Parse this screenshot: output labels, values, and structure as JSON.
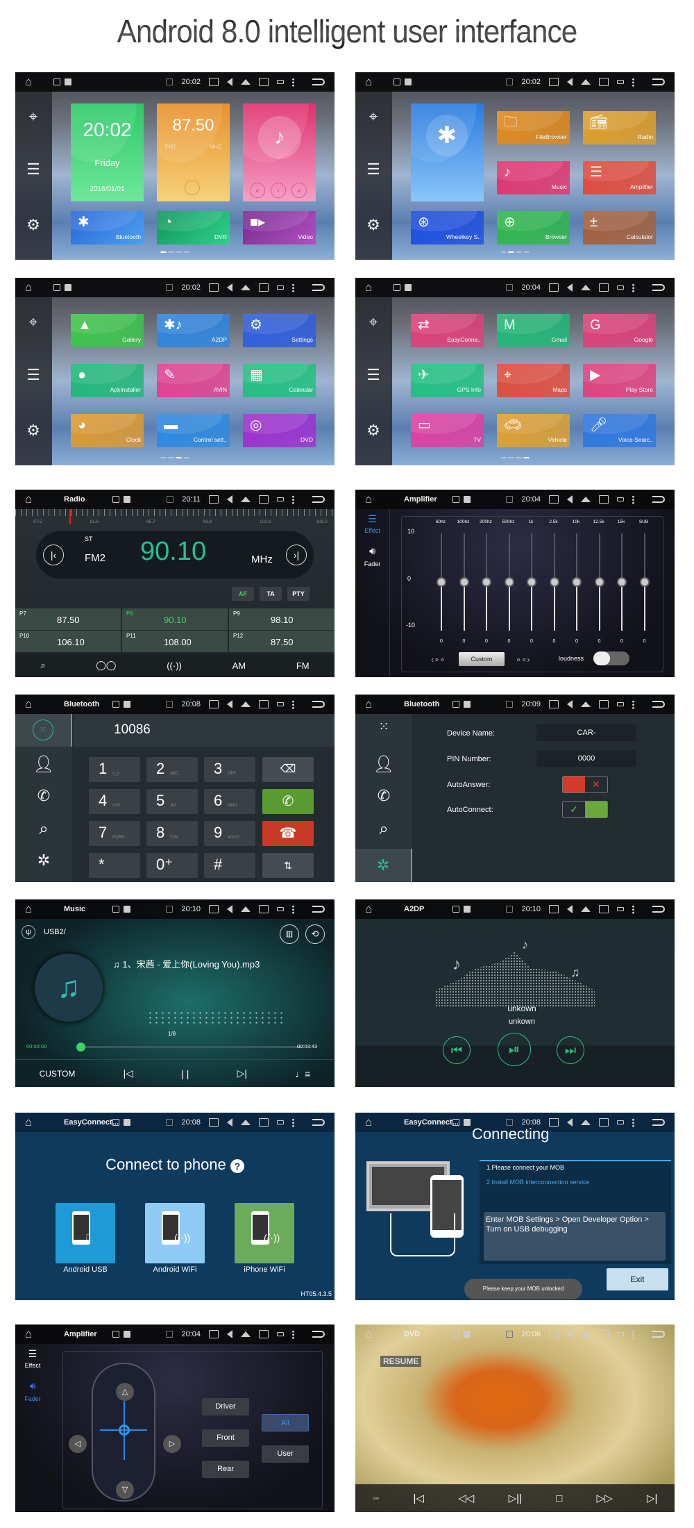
{
  "title": "Android 8.0 intelligent user interfance",
  "statusbar_icons": [
    "home-icon",
    "gallery-icon",
    "sd-card-icon",
    "no-sim-icon",
    "screenshot-icon",
    "volume-icon",
    "eject-icon",
    "close-window-icon",
    "recent-apps-icon",
    "more-icon",
    "back-icon"
  ],
  "screens": {
    "home1": {
      "time": "20:02",
      "clock": {
        "time": "20:02",
        "day": "Friday",
        "date": "2016/01/01"
      },
      "radio_widget": {
        "freq": "87.50",
        "band": "FM1",
        "unit": "MHZ"
      },
      "tiles": [
        {
          "label": "Bluetooth",
          "color": "#2f6fe0"
        },
        {
          "label": "DVR",
          "color": "#1aa56a"
        },
        {
          "label": "Video",
          "color": "#8e2fa0"
        }
      ]
    },
    "home2": {
      "time": "20:02",
      "tiles": [
        {
          "label": "FileBrowser",
          "color": "#e08a1c"
        },
        {
          "label": "Radio",
          "color": "#e0a02a"
        },
        {
          "label": "Music",
          "color": "#e0356e"
        },
        {
          "label": "Amplifier",
          "color": "#e04a3a"
        },
        {
          "label": "Wheelkey S..",
          "color": "#1e4fe0"
        },
        {
          "label": "Browser",
          "color": "#2fb84a"
        },
        {
          "label": "Calculator",
          "color": "#a5603a"
        }
      ]
    },
    "home3": {
      "time": "20:02",
      "tiles": [
        {
          "label": "Gallery",
          "color": "#3cc74a"
        },
        {
          "label": "A2DP",
          "color": "#2f86e0"
        },
        {
          "label": "Settings",
          "color": "#2f5ee0"
        },
        {
          "label": "ApkInstaller",
          "color": "#20b878"
        },
        {
          "label": "AVIN",
          "color": "#e0408e"
        },
        {
          "label": "Calendar",
          "color": "#20c080"
        },
        {
          "label": "Clock",
          "color": "#e09a30"
        },
        {
          "label": "Control sett..",
          "color": "#2f8ae0"
        },
        {
          "label": "DVD",
          "color": "#a030d0"
        }
      ]
    },
    "home4": {
      "time": "20:04",
      "tiles": [
        {
          "label": "EasyConne..",
          "color": "#e0407a"
        },
        {
          "label": "Gmail",
          "color": "#20b878"
        },
        {
          "label": "Google",
          "color": "#e0407a"
        },
        {
          "label": "GPS Info",
          "color": "#20c080"
        },
        {
          "label": "Maps",
          "color": "#e04a3a"
        },
        {
          "label": "Play Store",
          "color": "#e0407a"
        },
        {
          "label": "TV",
          "color": "#e040a0"
        },
        {
          "label": "Vehicle",
          "color": "#e0a030"
        },
        {
          "label": "Voice Searc..",
          "color": "#2f78e0"
        }
      ]
    },
    "radio": {
      "app": "Radio",
      "time": "20:11",
      "scale": [
        "87.5",
        "91.6",
        "95.7",
        "99.8",
        "103.9",
        "108.0"
      ],
      "st": "ST",
      "band": "FM2",
      "freq": "90.10",
      "unit": "MHz",
      "flags": [
        "AF",
        "TA",
        "PTY"
      ],
      "presets": [
        {
          "p": "P7",
          "f": "87.50"
        },
        {
          "p": "P8",
          "f": "90.10",
          "active": true
        },
        {
          "p": "P9",
          "f": "98.10"
        },
        {
          "p": "P10",
          "f": "106.10"
        },
        {
          "p": "P11",
          "f": "108.00"
        },
        {
          "p": "P12",
          "f": "87.50"
        }
      ],
      "bottom": [
        "search",
        "stereo",
        "rds",
        "AM",
        "FM"
      ],
      "am": "AM",
      "fm": "FM"
    },
    "eq": {
      "app": "Amplifier",
      "time": "20:04",
      "effect": "Effect",
      "fader": "Fader",
      "bands": [
        "60hz",
        "100hz",
        "200hz",
        "500hz",
        "1k",
        "2.5k",
        "10k",
        "12.5k",
        "15k",
        "SUB"
      ],
      "values": [
        0,
        0,
        0,
        0,
        0,
        0,
        0,
        0,
        0,
        0
      ],
      "scale": [
        "10",
        "0",
        "-10"
      ],
      "preset": "Custom",
      "loudness": "loudness"
    },
    "dialer": {
      "app": "Bluetooth",
      "time": "20:08",
      "number": "10086",
      "keys": [
        {
          "d": "1",
          "s": "ᴏ_ᴏ"
        },
        {
          "d": "2",
          "s": "ABC"
        },
        {
          "d": "3",
          "s": "DEF"
        },
        {
          "d": "4",
          "s": "GHI"
        },
        {
          "d": "5",
          "s": "JKL"
        },
        {
          "d": "6",
          "s": "MNO"
        },
        {
          "d": "7",
          "s": "PQRS"
        },
        {
          "d": "8",
          "s": "TUV"
        },
        {
          "d": "9",
          "s": "WXYZ"
        },
        {
          "d": "*",
          "s": ""
        },
        {
          "d": "0⁺",
          "s": ""
        },
        {
          "d": "#",
          "s": ""
        }
      ]
    },
    "bt_settings": {
      "app": "Bluetooth",
      "time": "20:09",
      "device_name_label": "Device Name:",
      "device_name": "CAR-",
      "pin_label": "PIN Number:",
      "pin": "0000",
      "auto_answer_label": "AutoAnswer:",
      "auto_answer": false,
      "auto_connect_label": "AutoConnect:",
      "auto_connect": true
    },
    "music": {
      "app": "Music",
      "time": "20:10",
      "source": "USB2/",
      "song": "1、宋茜 - 爱上你(Loving You).mp3",
      "track": "1/8",
      "elapsed": "00:00:00",
      "total": "00:03:43",
      "progress": 0,
      "mode": "CUSTOM"
    },
    "a2dp": {
      "app": "A2DP",
      "time": "20:10",
      "title": "unkown",
      "artist": "unkown"
    },
    "easyconnect": {
      "app": "EasyConnect...",
      "time": "20:08",
      "heading": "Connect to phone",
      "options": [
        {
          "label": "Android USB",
          "color": "#1e9ad6"
        },
        {
          "label": "Android WiFi",
          "color": "#8ecbf5"
        },
        {
          "label": "iPhone WiFi",
          "color": "#6aac5a"
        }
      ],
      "version": "HT05.4.3.5"
    },
    "connecting": {
      "app": "EasyConnect...",
      "time": "20:08",
      "heading": "Connecting",
      "step1": "1.Please connect your MOB",
      "step2": "2.Install MOB interconnection service",
      "instructions": "Enter MOB Settings > Open Developer Option > Turn on USB debugging",
      "exit": "Exit",
      "toast": "Please keep your MOB unlocked"
    },
    "fader": {
      "app": "Amplifier",
      "time": "20:04",
      "effect": "Effect",
      "fader": "Fader",
      "buttons": [
        "Driver",
        "Front",
        "Rear"
      ],
      "modes": [
        "All",
        "User"
      ]
    },
    "dvd": {
      "app": "DVD",
      "time": "20:06",
      "resume": "RESUME"
    }
  }
}
